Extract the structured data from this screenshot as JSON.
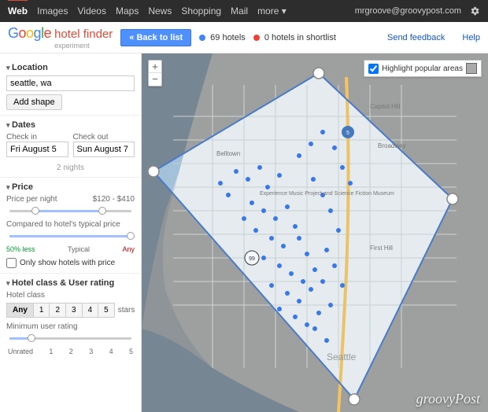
{
  "topnav": {
    "items": [
      "Web",
      "Images",
      "Videos",
      "Maps",
      "News",
      "Shopping",
      "Mail",
      "more ▾"
    ],
    "user": "mrgroove@groovypost.com"
  },
  "header": {
    "product": "hotel finder",
    "experiment": "experiment",
    "back_btn": "« Back to list",
    "hotels_count": "69 hotels",
    "shortlist_count": "0 hotels in shortlist",
    "feedback": "Send feedback",
    "help": "Help"
  },
  "sidebar": {
    "location": {
      "title": "Location",
      "value": "seattle, wa",
      "add_shape": "Add shape"
    },
    "dates": {
      "title": "Dates",
      "checkin_label": "Check in",
      "checkin_value": "Fri August 5",
      "checkout_label": "Check out",
      "checkout_value": "Sun August 7",
      "nights": "2 nights"
    },
    "price": {
      "title": "Price",
      "per_night_label": "Price per night",
      "range": "$120 - $410",
      "compare_label": "Compared to hotel's typical price",
      "less": "50% less",
      "typical": "Typical",
      "any": "Any",
      "only_price_label": "Only show hotels with price"
    },
    "class_rating": {
      "title": "Hotel class & User rating",
      "class_label": "Hotel class",
      "any": "Any",
      "stars_suffix": "stars",
      "min_rating_label": "Minimum user rating",
      "unrated": "Unrated"
    }
  },
  "map": {
    "highlight_label": "Highlight popular areas",
    "watermark": "groovyPost"
  }
}
